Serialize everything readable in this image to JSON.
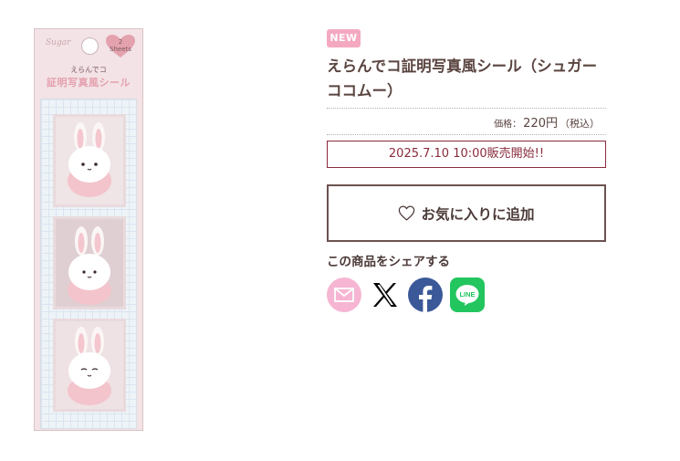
{
  "product_image": {
    "brand_text": "Sugar",
    "sheets_label": "2",
    "sheets_unit": "Sheets",
    "subtitle": "えらんでコ",
    "title": "証明写真風シール"
  },
  "badge": {
    "label": "NEW"
  },
  "product": {
    "title": "えらんでコ証明写真風シール（シュガーココムー）",
    "price_label": "価格：",
    "price_value": "220円",
    "tax_note": "（税込）"
  },
  "release": {
    "text": "2025.7.10 10:00販売開始!!"
  },
  "favorite": {
    "label": "お気に入りに追加",
    "icon": "heart-outline-icon"
  },
  "share": {
    "label": "この商品をシェアする",
    "items": [
      {
        "name": "mail",
        "icon": "envelope-icon",
        "color": "#f6b6d3"
      },
      {
        "name": "x",
        "icon": "x-logo-icon",
        "color": "#000000"
      },
      {
        "name": "facebook",
        "icon": "facebook-icon",
        "color": "#3b5998"
      },
      {
        "name": "line",
        "icon": "line-icon",
        "color": "#22c55e",
        "text": "LINE"
      }
    ]
  },
  "colors": {
    "accent": "#f4a9c1",
    "release_border": "#8a2b3c",
    "text": "#5a4440"
  }
}
